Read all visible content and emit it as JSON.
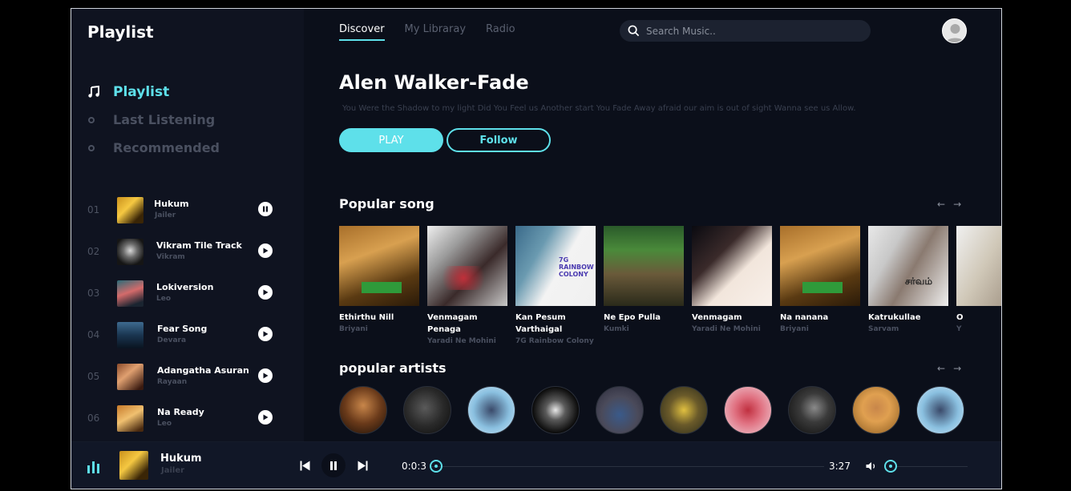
{
  "sidebar": {
    "logo": "Playlist",
    "menu": [
      {
        "label": "Playlist",
        "active": true
      },
      {
        "label": "Last Listening",
        "active": false
      },
      {
        "label": "Recommended",
        "active": false
      }
    ],
    "tracks": [
      {
        "num": "01",
        "name": "Hukum",
        "sub": "Jailer",
        "state": "pause"
      },
      {
        "num": "02",
        "name": "Vikram Tile Track",
        "sub": "Vikram",
        "state": "play"
      },
      {
        "num": "03",
        "name": "Lokiversion",
        "sub": "Leo",
        "state": "play"
      },
      {
        "num": "04",
        "name": "Fear Song",
        "sub": "Devara",
        "state": "play"
      },
      {
        "num": "05",
        "name": "Adangatha Asuran",
        "sub": "Rayaan",
        "state": "play"
      },
      {
        "num": "06",
        "name": "Na Ready",
        "sub": "Leo",
        "state": "play"
      }
    ]
  },
  "header": {
    "tabs": [
      {
        "label": "Discover",
        "active": true
      },
      {
        "label": "My Libraray",
        "active": false
      },
      {
        "label": "Radio",
        "active": false
      }
    ],
    "search_placeholder": "Search Music.."
  },
  "hero": {
    "title": "Alen Walker-Fade",
    "description": "You Were the Shadow to my light Did You Feel us Another start You Fade Away afraid our aim is out of sight Wanna see us Allow.",
    "play_label": "PLAY",
    "follow_label": "Follow"
  },
  "popular_songs": {
    "title": "Popular song",
    "items": [
      {
        "title": "Ethirthu Nill",
        "sub": "Briyani"
      },
      {
        "title": "Venmagam Penaga",
        "sub": "Yaradi Ne Mohini"
      },
      {
        "title": "Kan Pesum Varthaigal",
        "sub": "7G Rainbow Colony"
      },
      {
        "title": "Ne Epo Pulla",
        "sub": "Kumki"
      },
      {
        "title": "Venmagam",
        "sub": "Yaradi Ne Mohini"
      },
      {
        "title": "Na nanana",
        "sub": "Briyani"
      },
      {
        "title": "Katrukullae",
        "sub": "Sarvam"
      },
      {
        "title": "O",
        "sub": "Y"
      }
    ],
    "cover_text": {
      "rainbow": "7G RAINBOW COLONY",
      "sarvam": "சர்வம்"
    }
  },
  "popular_artists": {
    "title": "popular artists",
    "count": 10
  },
  "player": {
    "title": "Hukum",
    "sub": "Jailer",
    "current_time": "0:0:3",
    "total_time": "3:27",
    "progress": 0.0,
    "volume": 0.0
  },
  "colors": {
    "accent": "#5ee0ea",
    "background": "#0b0f1a",
    "sidebar": "#0f1320",
    "muted": "#4a5060"
  }
}
